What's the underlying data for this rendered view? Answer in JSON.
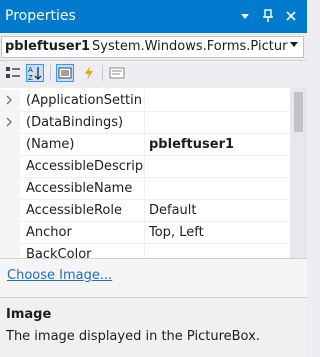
{
  "panel": {
    "title": "Properties"
  },
  "object": {
    "name": "pbleftuser1",
    "type": "System.Windows.Forms.Pictur"
  },
  "properties": [
    {
      "name": "(ApplicationSettin",
      "value": "",
      "expandable": true
    },
    {
      "name": "(DataBindings)",
      "value": "",
      "expandable": true
    },
    {
      "name": "(Name)",
      "value": "pbleftuser1",
      "expandable": false
    },
    {
      "name": "AccessibleDescrip",
      "value": "",
      "expandable": false
    },
    {
      "name": "AccessibleName",
      "value": "",
      "expandable": false
    },
    {
      "name": "AccessibleRole",
      "value": "Default",
      "expandable": false
    },
    {
      "name": "Anchor",
      "value": "Top, Left",
      "expandable": false
    },
    {
      "name": "BackColor",
      "value": "",
      "expandable": false
    }
  ],
  "commands": {
    "link": "Choose Image..."
  },
  "description": {
    "title": "Image",
    "text": "The image displayed in the PictureBox."
  },
  "colors": {
    "accent": "#007acc",
    "link": "#1e70b8",
    "selected": "#c9def5"
  },
  "icons": [
    "dropdown-arrow-icon",
    "pin-icon",
    "close-icon",
    "categorized-icon",
    "alphabetical-icon",
    "properties-icon",
    "events-icon",
    "property-pages-icon"
  ]
}
